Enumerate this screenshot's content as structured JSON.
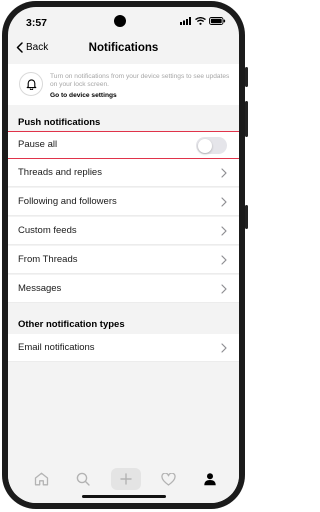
{
  "status_bar": {
    "time": "3:57",
    "icons": [
      "signal-icon",
      "wifi-icon",
      "battery-icon"
    ]
  },
  "nav": {
    "back_label": "Back",
    "title": "Notifications"
  },
  "banner": {
    "icon": "bell-icon",
    "text": "Turn on notifications from your device settings to see updates on your lock screen.",
    "link": "Go to device settings"
  },
  "push": {
    "heading": "Push notifications",
    "pause_all_label": "Pause all",
    "pause_all_enabled": false,
    "items": [
      {
        "label": "Threads and replies"
      },
      {
        "label": "Following and followers"
      },
      {
        "label": "Custom feeds"
      },
      {
        "label": "From Threads"
      },
      {
        "label": "Messages"
      }
    ]
  },
  "other": {
    "heading": "Other notification types",
    "items": [
      {
        "label": "Email notifications"
      }
    ]
  },
  "tab_bar": {
    "tabs": [
      "home-icon",
      "search-icon",
      "plus-icon",
      "heart-icon",
      "profile-icon"
    ],
    "active": "profile-icon"
  },
  "colors": {
    "highlight": "#e0334a",
    "background": "#f3f3f3"
  }
}
